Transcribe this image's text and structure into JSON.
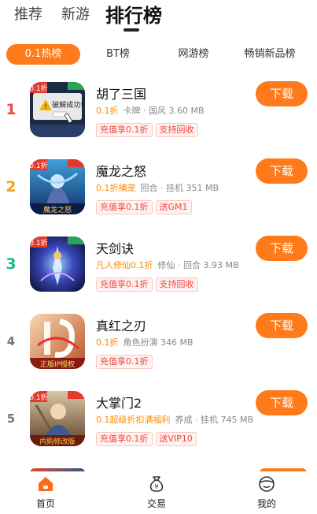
{
  "top_tabs": [
    "推荐",
    "新游",
    "排行榜"
  ],
  "sub_tabs": [
    "0.1热榜",
    "BT榜",
    "网游榜",
    "畅销新品榜"
  ],
  "games": [
    {
      "rank": "1",
      "name": "胡了三国",
      "discount": "0.1折",
      "info": "卡牌 · 国风  3.60 MB",
      "tags": [
        "充值享0.1折",
        "支持回收"
      ],
      "icon_text": "破解成功!",
      "icon_badge": "0.1折"
    },
    {
      "rank": "2",
      "name": "魔龙之怒",
      "discount": "0.1折捕宠",
      "info": "回合 · 挂机  351 MB",
      "tags": [
        "充值享0.1折",
        "送GM1"
      ],
      "icon_text": "魔龙之怒",
      "icon_badge": "0.1折"
    },
    {
      "rank": "3",
      "name": "天剑诀",
      "discount": "凡人修仙0.1折",
      "info": "修仙 · 回合  3.93 MB",
      "tags": [
        "充值享0.1折",
        "支持回收"
      ],
      "icon_text": "",
      "icon_badge": "0.1折"
    },
    {
      "rank": "4",
      "name": "真红之刃",
      "discount": "0.1折",
      "info": "角色扮演  346 MB",
      "tags": [
        "充值享0.1折"
      ],
      "icon_text": "正版IP授权",
      "icon_badge": ""
    },
    {
      "rank": "5",
      "name": "大掌门2",
      "discount": "0.1超级折扣满福利",
      "info": "养成 · 挂机  745 MB",
      "tags": [
        "充值享0.1折",
        "送VIP10"
      ],
      "icon_text": "内购修改版",
      "icon_badge": "0.1折"
    }
  ],
  "download_label": "下载",
  "bottom_nav": [
    "首页",
    "交易",
    "我的"
  ],
  "colors": {
    "accent": "#ff7a1a",
    "rank1": "#f04848",
    "rank2": "#f5a020",
    "rank3": "#18b98a"
  }
}
